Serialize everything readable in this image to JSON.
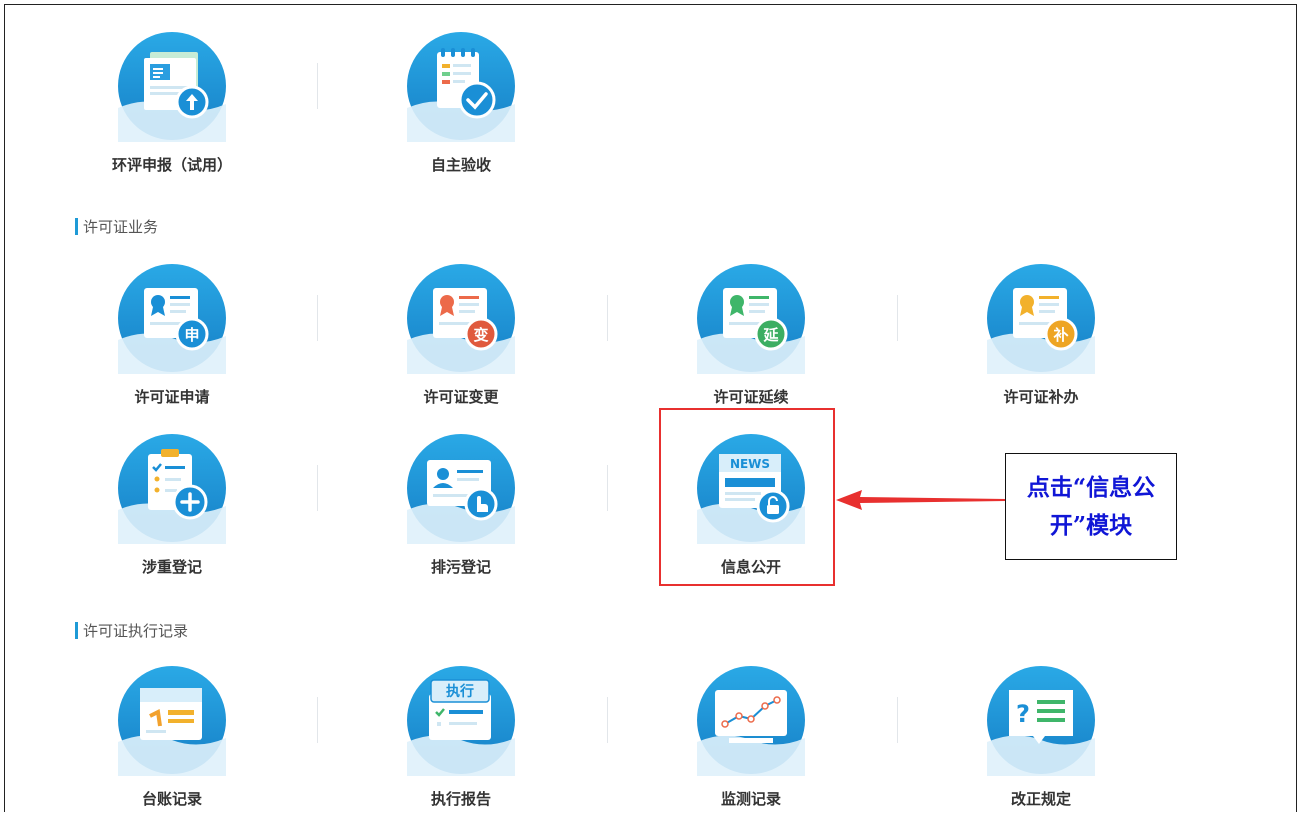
{
  "tiles": {
    "hp": {
      "label": "环评申报（试用）"
    },
    "zz": {
      "label": "自主验收"
    },
    "sq": {
      "label": "许可证申请",
      "badge": "申"
    },
    "bg": {
      "label": "许可证变更",
      "badge": "变"
    },
    "yx": {
      "label": "许可证延续",
      "badge": "延"
    },
    "bb": {
      "label": "许可证补办",
      "badge": "补"
    },
    "sz": {
      "label": "涉重登记"
    },
    "pw": {
      "label": "排污登记"
    },
    "xx": {
      "label": "信息公开",
      "badge": "NEWS"
    },
    "tz": {
      "label": "台账记录"
    },
    "zx": {
      "label": "执行报告",
      "badge": "执行"
    },
    "jc": {
      "label": "监测记录"
    },
    "gz": {
      "label": "改正规定",
      "badge": "?"
    }
  },
  "sections": {
    "permit": "许可证业务",
    "exec": "许可证执行记录"
  },
  "callout": {
    "text": "点击“信息公开”模块"
  },
  "colors": {
    "accent": "#1e9ad6",
    "highlight": "#e8302f",
    "callout_text": "#1016d6"
  }
}
